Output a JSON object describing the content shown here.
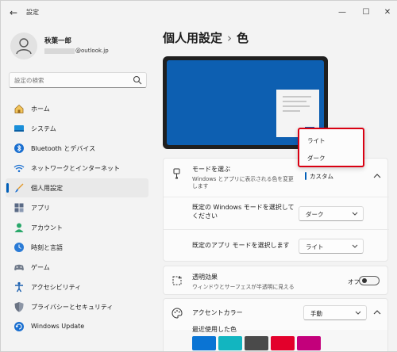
{
  "window": {
    "title": "設定"
  },
  "user": {
    "name": "秋葉一郎",
    "email_domain": "@outlook.jp"
  },
  "search": {
    "placeholder": "設定の検索"
  },
  "nav": [
    {
      "label": "ホーム",
      "icon": "home-icon"
    },
    {
      "label": "システム",
      "icon": "system-icon"
    },
    {
      "label": "Bluetooth とデバイス",
      "icon": "bluetooth-icon"
    },
    {
      "label": "ネットワークとインターネット",
      "icon": "network-icon"
    },
    {
      "label": "個人用設定",
      "icon": "personalization-icon",
      "selected": true
    },
    {
      "label": "アプリ",
      "icon": "apps-icon"
    },
    {
      "label": "アカウント",
      "icon": "account-icon"
    },
    {
      "label": "時刻と言語",
      "icon": "time-language-icon"
    },
    {
      "label": "ゲーム",
      "icon": "gaming-icon"
    },
    {
      "label": "アクセシビリティ",
      "icon": "accessibility-icon"
    },
    {
      "label": "プライバシーとセキュリティ",
      "icon": "privacy-security-icon"
    },
    {
      "label": "Windows Update",
      "icon": "windows-update-icon"
    }
  ],
  "breadcrumb": {
    "parent": "個人用設定",
    "separator": "›",
    "current": "色"
  },
  "mode": {
    "title": "モードを選ぶ",
    "description_line1": "Windows とアプリに表示される色を変更",
    "description_line2": "します",
    "value": "カスタム",
    "options": [
      "ライト",
      "ダーク"
    ]
  },
  "windows_mode": {
    "label_line1": "既定の Windows モードを選択して",
    "label_line2": "ください",
    "value": "ダーク"
  },
  "app_mode": {
    "label": "既定のアプリ モードを選択します",
    "value": "ライト"
  },
  "transparency": {
    "title": "透明効果",
    "description": "ウィンドウとサーフェスが半透明に見える",
    "state_label": "オフ",
    "enabled": false
  },
  "accent": {
    "title": "アクセントカラー",
    "value": "手動",
    "recent_label": "最近使用した色",
    "recent_colors": [
      "#0a74d4",
      "#12b5c0",
      "#4a4a4a",
      "#e3002b",
      "#c3007b"
    ]
  },
  "colors": {
    "accent": "#005fb8",
    "highlight_border": "#d90012",
    "preview_bg": "#0d5fb1"
  }
}
